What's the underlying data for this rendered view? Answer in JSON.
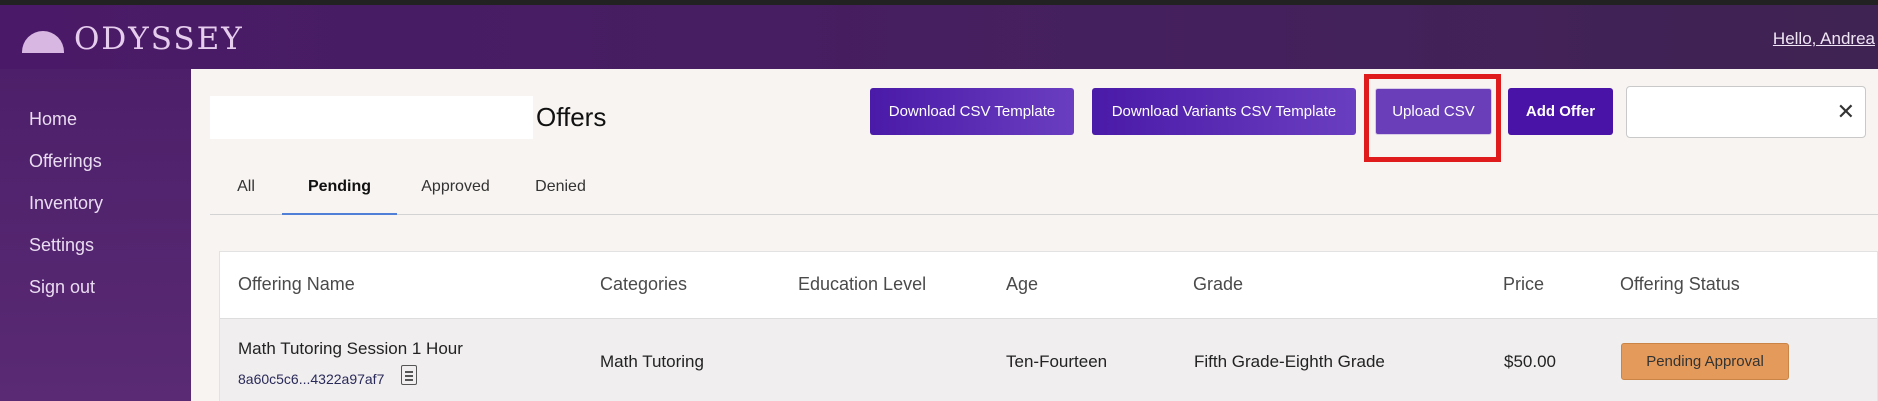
{
  "header": {
    "logo_text": "ODYSSEY",
    "greeting": "Hello, Andrea"
  },
  "sidebar": {
    "items": [
      {
        "label": "Home"
      },
      {
        "label": "Offerings"
      },
      {
        "label": "Inventory"
      },
      {
        "label": "Settings"
      },
      {
        "label": "Sign out"
      }
    ]
  },
  "main": {
    "title": "Offers",
    "buttons": {
      "download_csv": "Download CSV Template",
      "download_variants": "Download Variants CSV Template",
      "upload_csv": "Upload CSV",
      "add_offer": "Add Offer"
    },
    "search": {
      "value": "",
      "clear_glyph": "✕"
    },
    "tabs": [
      {
        "label": "All"
      },
      {
        "label": "Pending",
        "active": true
      },
      {
        "label": "Approved"
      },
      {
        "label": "Denied"
      }
    ]
  },
  "table": {
    "columns": [
      "Offering Name",
      "Categories",
      "Education Level",
      "Age",
      "Grade",
      "Price",
      "Offering Status"
    ],
    "rows": [
      {
        "offering_name": "Math Tutoring Session 1 Hour",
        "offering_id": "8a60c5c6...4322a97af7",
        "category": "Math Tutoring",
        "education_level": "",
        "age": "Ten-Fourteen",
        "grade": "Fifth Grade-Eighth Grade",
        "price": "$50.00",
        "status": "Pending Approval"
      }
    ]
  },
  "colors": {
    "brand_purple": "#4a1a68",
    "button_purple": "#4a13a8",
    "status_pending": "#e39a5a",
    "highlight_red": "#e01b1b"
  }
}
